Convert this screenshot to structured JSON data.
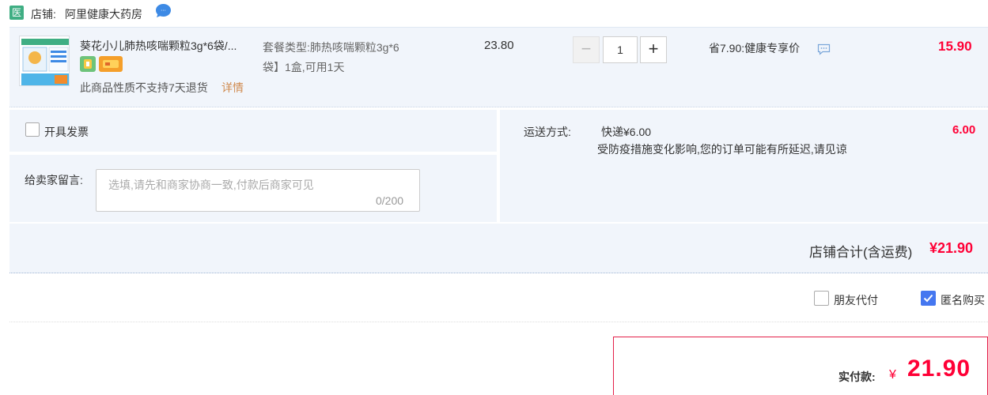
{
  "shop": {
    "badge": "医",
    "label": "店铺:",
    "name": "阿里健康大药房",
    "chat_icon": "chat-bubble-icon"
  },
  "item": {
    "title": "葵花小儿肺热咳喘颗粒3g*6袋/...",
    "note": "此商品性质不支持7天退货",
    "note_link": "详情",
    "sku_line1": "套餐类型:肺热咳喘颗粒3g*6",
    "sku_line2": "袋】1盒,可用1天",
    "unit_price": "23.80",
    "quantity": "1",
    "qty_minus": "−",
    "qty_plus": "+",
    "discount": "省7.90:健康专享价",
    "subtotal": "15.90",
    "service_icons": [
      "pharmacy-service-icon",
      "card-service-icon"
    ]
  },
  "options": {
    "invoice_label": "开具发票",
    "memo_label": "给卖家留言:",
    "memo_placeholder": "选填,请先和商家协商一致,付款后商家可见",
    "memo_count": "0/200",
    "shipping_label": "运送方式:",
    "shipping_method": "快递¥6.00",
    "shipping_note": "受防疫措施变化影响,您的订单可能有所延迟,请见谅",
    "shipping_fee": "6.00"
  },
  "store_total": {
    "label": "店铺合计(含运费)",
    "value": "¥21.90"
  },
  "pay_options": {
    "friend_pay": "朋友代付",
    "anonymous": "匿名购买",
    "anonymous_checked": true
  },
  "summary": {
    "label": "实付款:",
    "currency": "¥",
    "amount": "21.90"
  },
  "colors": {
    "price_red": "#ff0036",
    "row_bg": "#f1f5fb",
    "checkbox_blue": "#4577f0",
    "shop_green": "#3fae83"
  }
}
